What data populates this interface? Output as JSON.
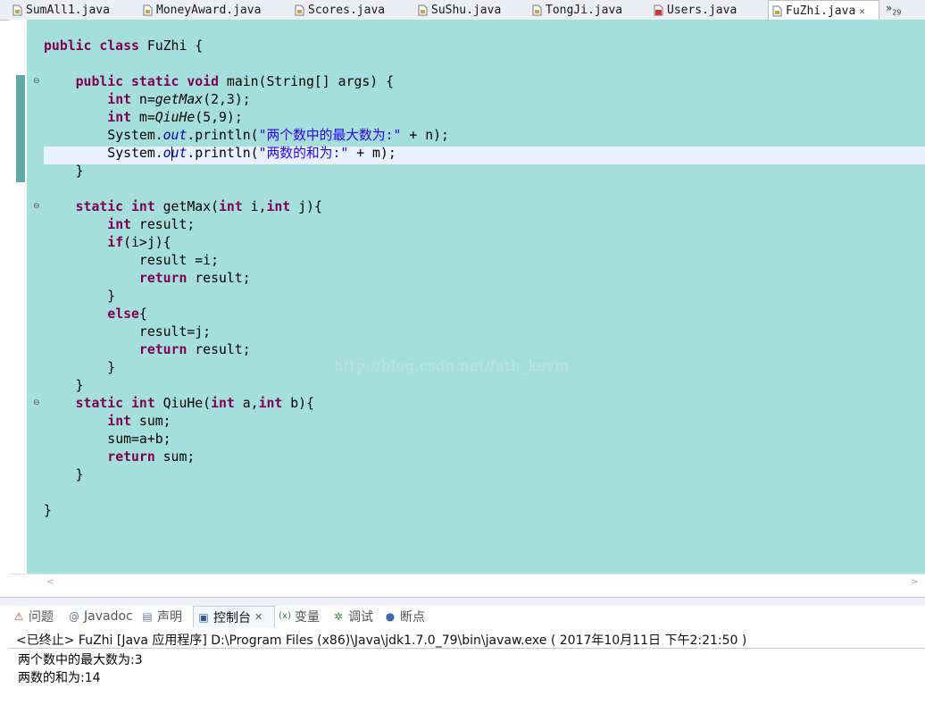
{
  "tabs": [
    {
      "label": "SumAll1.java",
      "icon": "java-file-icon"
    },
    {
      "label": "MoneyAward.java",
      "icon": "java-file-icon"
    },
    {
      "label": "Scores.java",
      "icon": "java-file-icon"
    },
    {
      "label": "SuShu.java",
      "icon": "java-file-icon"
    },
    {
      "label": "TongJi.java",
      "icon": "java-file-icon"
    },
    {
      "label": "Users.java",
      "icon": "java-file-error-icon"
    },
    {
      "label": "FuZhi.java",
      "icon": "java-file-icon",
      "active": true
    }
  ],
  "tab_overflow": {
    "symbol": "»",
    "count": "29"
  },
  "code": {
    "l1_kw": "public class",
    "l1_rest": " FuZhi {",
    "l3_kw1": "public static void",
    "l3_rest": " main(String[] args) {",
    "l4_kw": "int",
    "l4_a": " n=",
    "l4_m": "getMax",
    "l4_b": "(2,3);",
    "l5_kw": "int",
    "l5_a": " m=",
    "l5_m": "QiuHe",
    "l5_b": "(5,9);",
    "l6_a": "System.",
    "l6_f": "out",
    "l6_b": ".println(",
    "l6_s": "\"两个数中的最大数为:\"",
    "l6_c": " + n);",
    "l7_a": "System.",
    "l7_f1": "o",
    "l7_f2": "ut",
    "l7_b": ".println(",
    "l7_s": "\"两数的和为:\"",
    "l7_c": " + m);",
    "l8": "}",
    "l10_kw": "static int",
    "l10_a": " getMax(",
    "l10_k2": "int",
    "l10_b": " i,",
    "l10_k3": "int",
    "l10_c": " j){",
    "l11_kw": "int",
    "l11_a": " result;",
    "l12_kw": "if",
    "l12_a": "(i>j){",
    "l13": "result =i;",
    "l14_kw": "return",
    "l14_a": " result;",
    "l15": "}",
    "l16_kw": "else",
    "l16_a": "{",
    "l17": "result=j;",
    "l18_kw": "return",
    "l18_a": " result;",
    "l19": "}",
    "l20": "}",
    "l21_kw": "static int",
    "l21_a": " QiuHe(",
    "l21_k2": "int",
    "l21_b": " a,",
    "l21_k3": "int",
    "l21_c": " b){",
    "l22_kw": "int",
    "l22_a": " sum;",
    "l23": "sum=a+b;",
    "l24_kw": "return",
    "l24_a": " sum;",
    "l25": "}",
    "l27": "}"
  },
  "watermark": "http://blog.csdn.net/fath_kevin",
  "console_tabs": [
    {
      "label": "问题",
      "icon": "problems-icon"
    },
    {
      "label": "Javadoc",
      "icon": "javadoc-icon"
    },
    {
      "label": "声明",
      "icon": "declaration-icon"
    },
    {
      "label": "控制台",
      "icon": "console-icon",
      "active": true
    },
    {
      "label": "变量",
      "icon": "variables-icon"
    },
    {
      "label": "调试",
      "icon": "debug-icon"
    },
    {
      "label": "断点",
      "icon": "breakpoints-icon"
    }
  ],
  "console_status": "<已终止> FuZhi [Java 应用程序] D:\\Program Files (x86)\\Java\\jdk1.7.0_79\\bin\\javaw.exe ( 2017年10月11日 下午2:21:50 )",
  "console_output": [
    "两个数中的最大数为:3",
    "两数的和为:14"
  ],
  "colors": {
    "editor_bg": "#a5dfdb",
    "keyword": "#7f0055",
    "string": "#2a00ff",
    "field": "#0000c0",
    "current_line": "#e8f2fe"
  }
}
